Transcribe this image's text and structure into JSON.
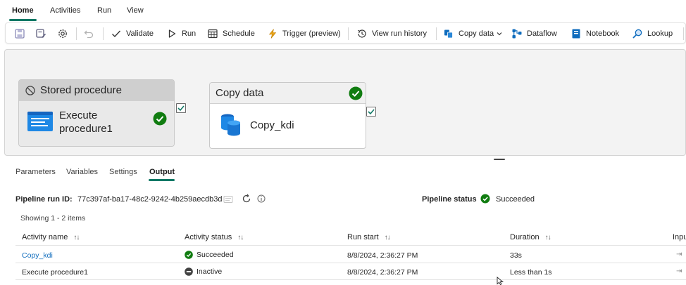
{
  "menu": {
    "tabs": [
      {
        "label": "Home",
        "active": true
      },
      {
        "label": "Activities",
        "active": false
      },
      {
        "label": "Run",
        "active": false
      },
      {
        "label": "View",
        "active": false
      }
    ]
  },
  "toolbar": {
    "items": [
      {
        "label": "Validate",
        "icon": "checkmark-icon"
      },
      {
        "label": "Run",
        "icon": "play-icon"
      },
      {
        "label": "Schedule",
        "icon": "calendar-icon"
      },
      {
        "label": "Trigger (preview)",
        "icon": "lightning-icon"
      },
      {
        "label": "View run history",
        "icon": "history-icon"
      },
      {
        "label": "Copy data",
        "icon": "copy-data-icon"
      },
      {
        "label": "Dataflow",
        "icon": "dataflow-icon"
      },
      {
        "label": "Notebook",
        "icon": "notebook-icon"
      },
      {
        "label": "Lookup",
        "icon": "lookup-icon"
      }
    ]
  },
  "canvas": {
    "activities": [
      {
        "type_label": "Stored procedure",
        "name_line1": "Execute",
        "name_line2": "procedure1",
        "state": "inactive"
      },
      {
        "type_label": "Copy data",
        "name": "Copy_kdi",
        "state": "succeeded"
      }
    ]
  },
  "panel": {
    "tabs": [
      {
        "label": "Parameters",
        "active": false
      },
      {
        "label": "Variables",
        "active": false
      },
      {
        "label": "Settings",
        "active": false
      },
      {
        "label": "Output",
        "active": true
      }
    ],
    "run_id_label": "Pipeline run ID:",
    "run_id": "77c397af-ba17-48c2-9242-4b259aecdb3d",
    "status_label": "Pipeline status",
    "status": "Succeeded",
    "showing": "Showing 1 - 2 items",
    "columns": [
      "Activity name",
      "Activity status",
      "Run start",
      "Duration",
      "Inpu"
    ],
    "rows": [
      {
        "name": "Copy_kdi",
        "status": "Succeeded",
        "run_start": "8/8/2024, 2:36:27 PM",
        "duration": "33s"
      },
      {
        "name": "Execute procedure1",
        "status": "Inactive",
        "run_start": "8/8/2024, 2:36:27 PM",
        "duration": "Less than 1s"
      }
    ]
  },
  "colors": {
    "accent": "#117865",
    "success": "#107c10",
    "link": "#0f6cbd",
    "toolbar_icon_blue": "#0f6cbd",
    "trigger_icon": "#e8a317"
  }
}
